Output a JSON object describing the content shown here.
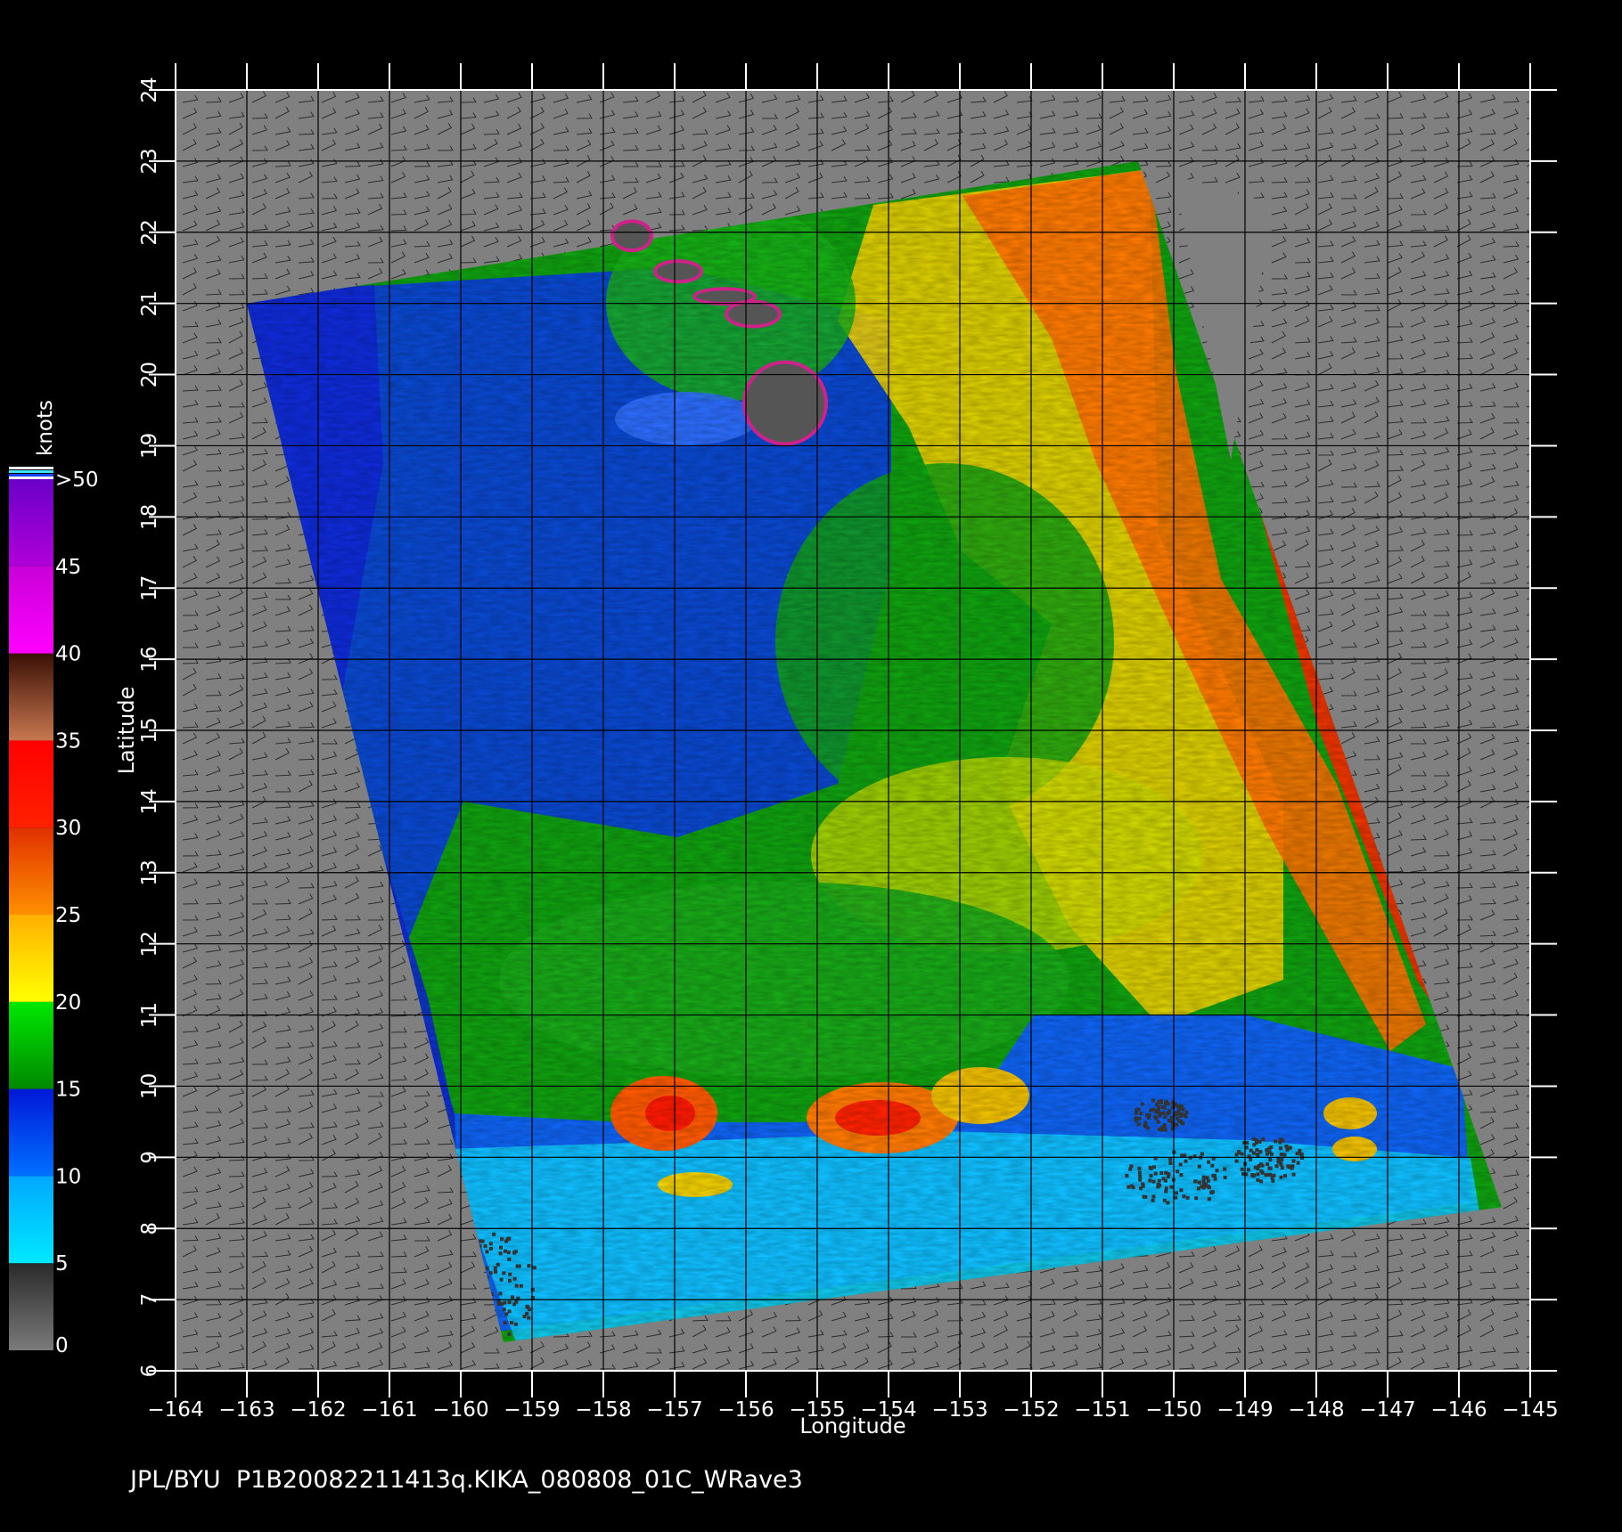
{
  "map": {
    "xlabel": "Longitude",
    "ylabel": "Latitude",
    "lon_ticks": [
      "−164",
      "−163",
      "−162",
      "−161",
      "−160",
      "−159",
      "−158",
      "−157",
      "−156",
      "−155",
      "−154",
      "−153",
      "−152",
      "−151",
      "−150",
      "−149",
      "−148",
      "−147",
      "−146",
      "−145"
    ],
    "lat_ticks": [
      "6",
      "7",
      "8",
      "9",
      "10",
      "11",
      "12",
      "13",
      "14",
      "15",
      "16",
      "17",
      "18",
      "19",
      "20",
      "21",
      "22",
      "23",
      "24"
    ],
    "lon_range": [
      -164,
      -145
    ],
    "lat_range": [
      6,
      24
    ],
    "background_color": "#808080",
    "grid_color": "#000000",
    "land_color": "#555555"
  },
  "colorbar": {
    "title": "knots",
    "labels": [
      "0",
      "5",
      "10",
      "15",
      "20",
      "25",
      "30",
      "35",
      "40",
      "45",
      ">50"
    ],
    "bands": [
      {
        "range": [
          0,
          5
        ],
        "from": "#7a7a7a",
        "to": "#2a2a2a"
      },
      {
        "range": [
          5,
          10
        ],
        "from": "#00e8ff",
        "to": "#00a8ff"
      },
      {
        "range": [
          10,
          15
        ],
        "from": "#0070ff",
        "to": "#0018d8"
      },
      {
        "range": [
          15,
          20
        ],
        "from": "#008800",
        "to": "#00e800"
      },
      {
        "range": [
          20,
          25
        ],
        "from": "#ffff00",
        "to": "#ffb000"
      },
      {
        "range": [
          25,
          30
        ],
        "from": "#ff9000",
        "to": "#e03000"
      },
      {
        "range": [
          30,
          35
        ],
        "from": "#ff2000",
        "to": "#ff0000"
      },
      {
        "range": [
          35,
          40
        ],
        "from": "#c87850",
        "to": "#3a1005"
      },
      {
        "range": [
          40,
          45
        ],
        "from": "#ff00ff",
        "to": "#c800d8"
      },
      {
        "range": [
          45,
          50
        ],
        "from": "#b000d8",
        "to": "#6a00c8"
      }
    ]
  },
  "swath": {
    "corners": [
      [
        -163,
        21
      ],
      [
        -150.5,
        23
      ],
      [
        -145.4,
        8.3
      ],
      [
        -159.4,
        6.4
      ]
    ],
    "gap_corners": [
      [
        -150,
        22.8
      ],
      [
        -148.6,
        22.4
      ],
      [
        -149.2,
        18.8
      ]
    ]
  },
  "islands": [
    {
      "name": "Kauai",
      "lon": -157.6,
      "lat": 21.95,
      "rx": 0.25,
      "ry": 0.18
    },
    {
      "name": "Oahu",
      "lon": -156.95,
      "lat": 21.45,
      "rx": 0.3,
      "ry": 0.12
    },
    {
      "name": "Molokai",
      "lon": -156.3,
      "lat": 21.1,
      "rx": 0.4,
      "ry": 0.08
    },
    {
      "name": "Maui",
      "lon": -155.9,
      "lat": 20.85,
      "rx": 0.35,
      "ry": 0.15
    },
    {
      "name": "Hawaii",
      "lon": -155.45,
      "lat": 19.6,
      "rx": 0.55,
      "ry": 0.55
    }
  ],
  "credit": {
    "org": "JPL/BYU",
    "file": "P1B20082211413q.KIKA_080808_01C_WRave3"
  }
}
